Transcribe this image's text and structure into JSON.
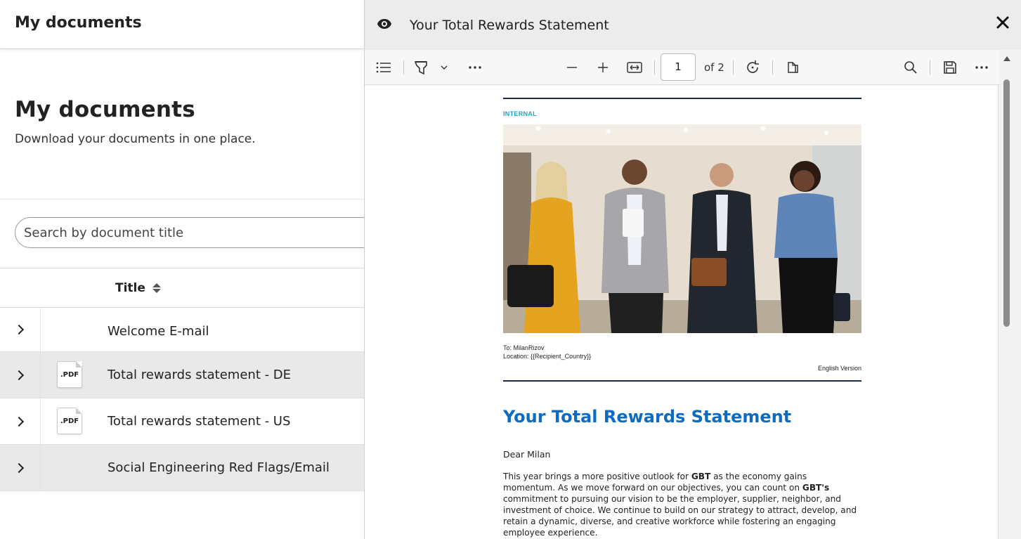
{
  "left": {
    "header_title": "My documents",
    "heading": "My documents",
    "subtitle": "Download your documents in one place.",
    "search_placeholder": "Search by document title",
    "table": {
      "column_title": "Title",
      "rows": [
        {
          "title": "Welcome E-mail",
          "has_pdf": false
        },
        {
          "title": "Total rewards statement - DE",
          "has_pdf": true,
          "pdf_label": ".PDF"
        },
        {
          "title": "Total rewards statement - US",
          "has_pdf": true,
          "pdf_label": ".PDF"
        },
        {
          "title": "Social Engineering Red Flags/Email",
          "has_pdf": false
        }
      ]
    }
  },
  "viewer": {
    "title": "Your Total Rewards Statement",
    "page_current": "1",
    "page_total_label": "of 2",
    "icons": [
      "eye-icon",
      "close-icon",
      "contents-icon",
      "highlight-icon",
      "chevron-down-icon",
      "more-icon",
      "zoom-out-icon",
      "zoom-in-icon",
      "fit-width-icon",
      "rotate-icon",
      "page-view-icon",
      "search-icon",
      "save-icon",
      "more-options-icon"
    ]
  },
  "document": {
    "classification": "INTERNAL",
    "to_line": "To: MilanRizov",
    "location_line": "Location: {{Recipient_Country}}",
    "language": "English Version",
    "heading": "Your Total Rewards Statement",
    "greeting": "Dear Milan",
    "para_parts": [
      "This year brings a more positive outlook for ",
      "GBT",
      " as the economy gains momentum. As we move forward on our objectives, you can count on ",
      "GBT's",
      "  commitment to pursuing our vision to be the employer, supplier, neighbor, and investment of choice. We continue to build on our strategy to attract, develop, and retain a dynamic, diverse, and creative workforce while fostering an engaging employee experience."
    ]
  },
  "colors": {
    "accent_blue": "#0d6cc2",
    "internal_teal": "#1aa6c8",
    "rule_navy": "#1a2b45",
    "row_shade": "#e9e9e9"
  }
}
